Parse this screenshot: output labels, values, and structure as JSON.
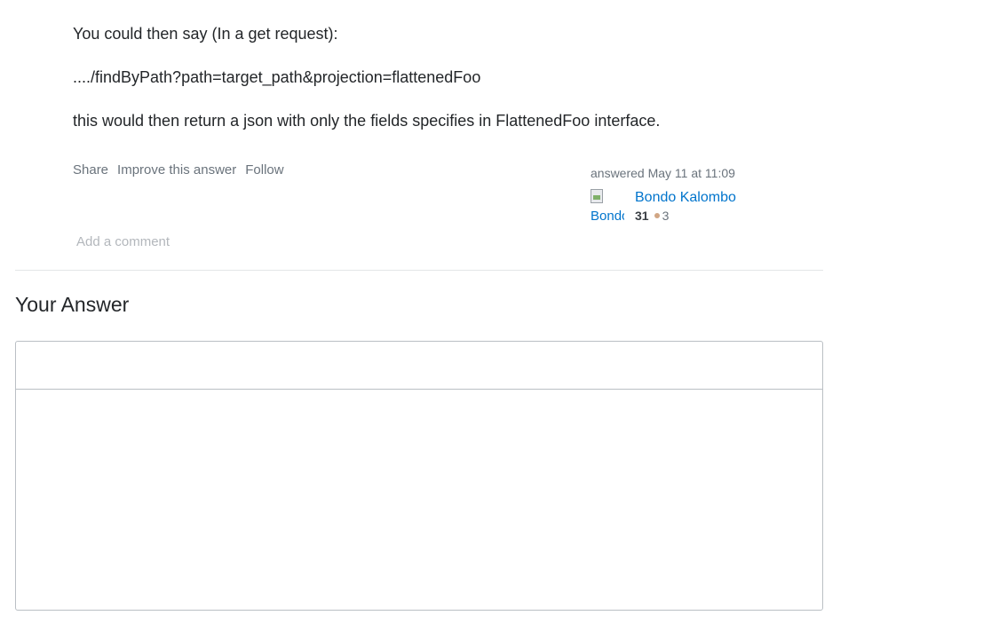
{
  "answer": {
    "paragraphs": [
      "You could then say (In a get request):",
      "..../findByPath?path=target_path&projection=flattenedFoo",
      "this would then return a json with only the fields specifies in FlattenedFoo interface."
    ]
  },
  "post_menu": {
    "share": "Share",
    "improve": "Improve this answer",
    "follow": "Follow"
  },
  "user_card": {
    "action_time": "answered May 11 at 11:09",
    "avatar_alt": "Bondo Kalombo",
    "name": "Bondo Kalombo",
    "reputation": "31",
    "bronze_badges": "3",
    "bronze_color": "#d1a684"
  },
  "comments": {
    "add_comment": "Add a comment"
  },
  "your_answer": {
    "title": "Your Answer"
  },
  "colors": {
    "link": "#0074cc",
    "muted": "#6a737c",
    "text": "#232629",
    "border": "#babfc4"
  }
}
